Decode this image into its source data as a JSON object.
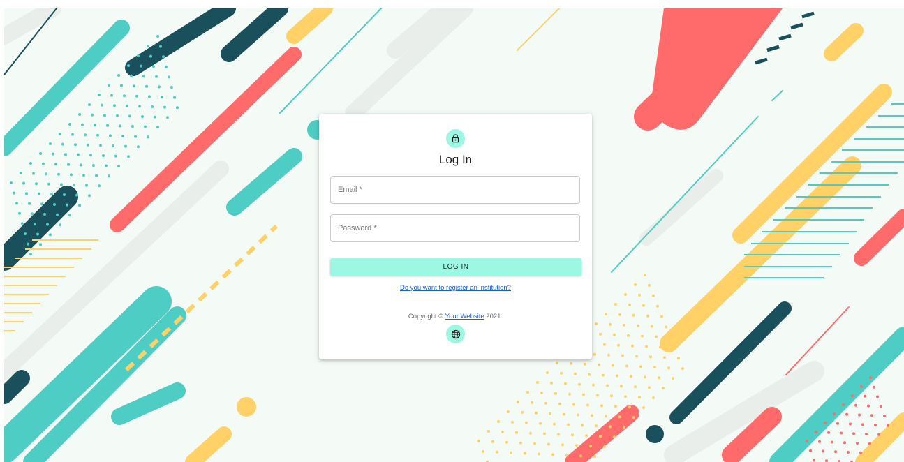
{
  "login": {
    "lock_icon": "lock-icon",
    "title": "Log In",
    "email_placeholder": "Email *",
    "password_placeholder": "Password *",
    "login_label": "LOG IN",
    "register_link": "Do you want to register an institution?",
    "copyright_prefix": "Copyright © ",
    "copyright_link": "Your Website",
    "copyright_suffix": " 2021.",
    "globe_icon": "globe-icon"
  },
  "colors": {
    "accent": "#9cf7e3",
    "link": "#1a62d4",
    "bg_teal": "#4ecdc4",
    "bg_navy": "#1a4f5c",
    "bg_coral": "#ff6b6b",
    "bg_yellow": "#ffd166",
    "bg_mint": "#f4faf6"
  }
}
